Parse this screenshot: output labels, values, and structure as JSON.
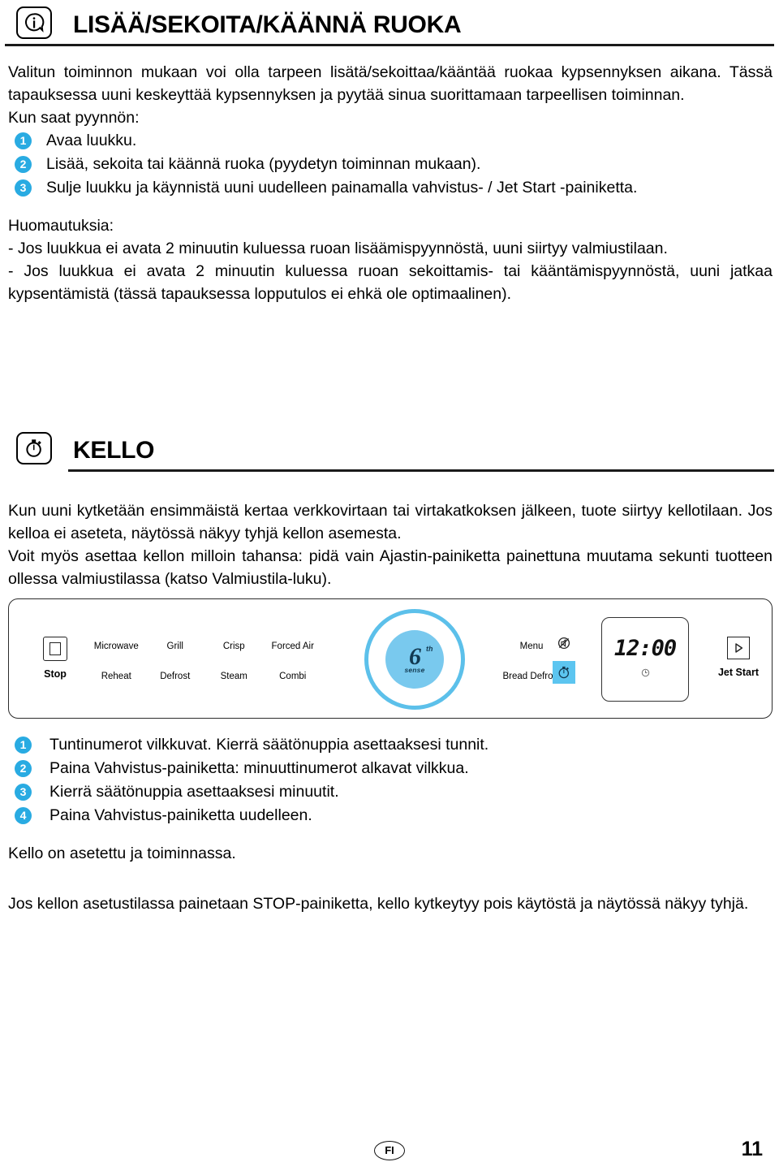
{
  "sections": [
    {
      "icon": "info-icon",
      "title": "LISÄÄ/SEKOITA/KÄÄNNÄ RUOKA",
      "intro": "Valitun toiminnon mukaan voi olla tarpeen lisätä/sekoittaa/kääntää ruokaa kypsennyksen aikana. Tässä tapauksessa uuni keskeyttää kypsennyksen ja pyytää sinua suorittamaan tarpeellisen toiminnan.",
      "prompt_line": "Kun saat pyynnön:",
      "steps": [
        {
          "num": "1",
          "text": "Avaa luukku."
        },
        {
          "num": "2",
          "text": "Lisää, sekoita tai käännä ruoka (pyydetyn toiminnan mukaan)."
        },
        {
          "num": "3",
          "text": "Sulje luukku ja käynnistä uuni uudelleen painamalla vahvistus- / Jet Start -painiketta."
        }
      ],
      "notes_title": "Huomautuksia:",
      "notes": [
        "- Jos luukkua ei avata 2 minuutin kuluessa ruoan lisäämispyynnöstä, uuni siirtyy valmiustilaan.",
        "- Jos luukkua ei avata 2 minuutin kuluessa ruoan sekoittamis- tai kääntämispyynnöstä, uuni jatkaa kypsentämistä (tässä tapauksessa lopputulos ei ehkä ole optimaalinen)."
      ]
    },
    {
      "icon": "stopwatch-icon",
      "title": "KELLO",
      "paragraphs": [
        "Kun uuni kytketään ensimmäistä kertaa verkkovirtaan tai virtakatkoksen jälkeen, tuote siirtyy kellotilaan. Jos kelloa ei aseteta, näytössä näkyy tyhjä kellon asemesta.",
        "Voit myös asettaa kellon milloin tahansa: pidä vain Ajastin-painiketta painettuna muutama sekunti tuotteen ollessa valmiustilassa (katso Valmiustila-luku)."
      ],
      "steps": [
        {
          "num": "1",
          "text": "Tuntinumerot vilkkuvat. Kierrä säätönuppia asettaaksesi tunnit."
        },
        {
          "num": "2",
          "text": "Paina Vahvistus-painiketta: minuuttinumerot alkavat vilkkua."
        },
        {
          "num": "3",
          "text": "Kierrä säätönuppia asettaaksesi minuutit."
        },
        {
          "num": "4",
          "text": "Paina Vahvistus-painiketta uudelleen."
        }
      ],
      "closing": "Kello on asetettu ja toiminnassa.",
      "final_note": "Jos kellon asetustilassa painetaan STOP-painiketta, kello kytkeytyy pois käytöstä ja näytössä näkyy tyhjä."
    }
  ],
  "panel": {
    "stop_label": "Stop",
    "stop_icon": "stop-square-icon",
    "functions_row1": [
      "Microwave",
      "Grill",
      "Crisp",
      "Forced Air"
    ],
    "functions_row2": [
      "Reheat",
      "Defrost",
      "Steam",
      "Combi"
    ],
    "knob": {
      "icon": "sixth-sense-knob",
      "digit": "6",
      "superscript": "th",
      "wordmark": "sense",
      "ring_color": "#5cc0ea",
      "inner_color": "#79c9ee"
    },
    "menu_label": "Menu",
    "bread_defrost_label": "Bread Defrost",
    "mute_icon": "sound-off-icon",
    "timer_icon": "timer-stopwatch-icon",
    "timer_button_color": "#5cc5f0",
    "display_time": "12:00",
    "display_sub_icon": "clock-indicator-icon",
    "jet_start_label": "Jet Start",
    "jet_start_icon": "play-triangle-icon"
  },
  "footer": {
    "language_code": "FI",
    "page_number": "11"
  }
}
